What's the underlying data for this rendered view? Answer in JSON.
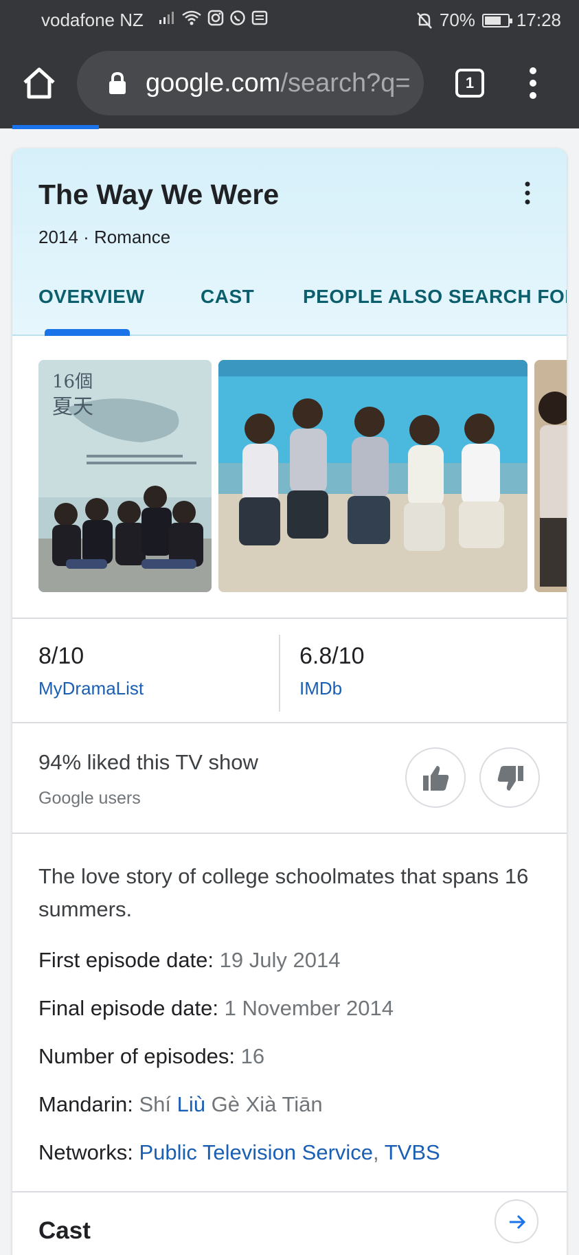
{
  "status_bar": {
    "carrier": "vodafone NZ",
    "battery": "70%",
    "battery_level": 0.7,
    "time": "17:28"
  },
  "browser": {
    "url_host": "google.com",
    "url_path": "/search?q=",
    "tab_count": "1"
  },
  "knowledge_panel": {
    "title": "The Way We Were",
    "subtitle": "2014 · Romance",
    "tabs": [
      {
        "label": "OVERVIEW",
        "active": true
      },
      {
        "label": "CAST"
      },
      {
        "label": "PEOPLE ALSO SEARCH FOR"
      }
    ],
    "ratings": [
      {
        "score": "8/10",
        "source": "MyDramaList"
      },
      {
        "score": "6.8/10",
        "source": "IMDb"
      }
    ],
    "liked": {
      "text": "94% liked this TV show",
      "source": "Google users"
    },
    "description": "The love story of college schoolmates that spans 16 summers.",
    "facts": {
      "first_label": "First episode date:",
      "first_value": "19 July 2014",
      "final_label": "Final episode date:",
      "final_value": "1 November 2014",
      "episodes_label": "Number of episodes:",
      "episodes_value": "16",
      "mandarin_label": "Mandarin:",
      "mandarin_part1": "Shí",
      "mandarin_link": "Liù",
      "mandarin_part2": "Gè Xià Tiān",
      "networks_label": "Networks:",
      "networks_1": "Public Television Service",
      "networks_sep": ",",
      "networks_2": "TVBS"
    },
    "cast_heading": "Cast"
  }
}
